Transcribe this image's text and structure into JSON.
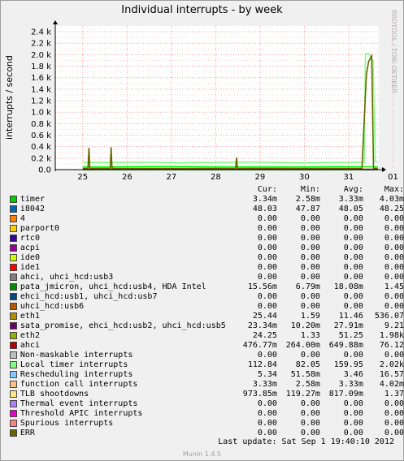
{
  "header": {
    "title": "Individual interrupts - by week",
    "watermark": "RRDTOOL / TOBI OETIKER"
  },
  "chart_data": {
    "type": "line",
    "title": "Individual interrupts - by week",
    "ylabel": "interrupts / second",
    "ylim": [
      0,
      2500
    ],
    "y_ticks": [
      "0.0",
      "0.2 k",
      "0.4 k",
      "0.6 k",
      "0.8 k",
      "1.0 k",
      "1.2 k",
      "1.4 k",
      "1.6 k",
      "1.8 k",
      "2.0 k",
      "2.2 k",
      "2.4 k"
    ],
    "x_ticks": [
      "25",
      "26",
      "27",
      "28",
      "29",
      "30",
      "31",
      "01"
    ],
    "grid": true,
    "series": [
      {
        "name": "Local timer interrupts",
        "color": "#80ff80",
        "x": [
          0,
          0.5,
          1.0,
          1.6,
          2.2,
          3.0,
          3.9,
          4.5,
          5.0,
          5.8,
          6.2,
          6.35,
          6.38,
          6.45,
          6.5,
          6.55,
          6.6,
          6.66
        ],
        "values": [
          130,
          125,
          130,
          128,
          122,
          128,
          132,
          124,
          122,
          126,
          128,
          128,
          2020,
          2020,
          1950,
          1900,
          140,
          130
        ]
      },
      {
        "name": "eth2",
        "color": "#00ff00",
        "x": [
          0,
          0.5,
          1.0,
          2.0,
          3.0,
          4.0,
          5.0,
          6.0,
          6.66
        ],
        "values": [
          50,
          48,
          52,
          55,
          50,
          48,
          50,
          52,
          50
        ]
      },
      {
        "name": "sata_promise, ehci_hcd:usb2, uhci_hcd:usb5",
        "color": "#666600",
        "x": [
          0,
          0.12,
          0.14,
          0.16,
          0.5,
          0.62,
          0.64,
          0.66,
          1.0,
          2.0,
          3.45,
          3.47,
          3.49,
          4.0,
          6.3,
          6.4,
          6.45,
          6.52,
          6.56,
          6.6,
          6.66
        ],
        "values": [
          22,
          22,
          380,
          22,
          22,
          22,
          390,
          22,
          22,
          22,
          22,
          210,
          22,
          22,
          22,
          1650,
          1880,
          1980,
          22,
          22,
          22
        ]
      },
      {
        "name": "ahci",
        "color": "#cc0000",
        "x": [
          0,
          1.0,
          2.0,
          3.0,
          4.0,
          5.0,
          6.0,
          6.66
        ],
        "values": [
          5,
          4,
          5,
          4,
          5,
          4,
          5,
          5
        ]
      },
      {
        "name": "i8042",
        "color": "#0066b3",
        "x": [
          0,
          3.3,
          6.66
        ],
        "values": [
          0.05,
          0.05,
          0.05
        ]
      },
      {
        "name": "timer",
        "color": "#00cc00",
        "x": [
          0,
          3.3,
          6.66
        ],
        "values": [
          0.003,
          0.003,
          0.003
        ]
      }
    ]
  },
  "legend": {
    "headers": {
      "cur": "Cur:",
      "min": "Min:",
      "avg": "Avg:",
      "max": "Max:"
    },
    "rows": [
      {
        "name": "timer",
        "color": "#00cc00",
        "cur": "3.34m",
        "min": "2.58m",
        "avg": "3.33m",
        "max": "4.03m"
      },
      {
        "name": "i8042",
        "color": "#0066b3",
        "cur": "48.03",
        "min": "47.87",
        "avg": "48.05",
        "max": "48.25"
      },
      {
        "name": "4",
        "color": "#ff8000",
        "cur": "0.00",
        "min": "0.00",
        "avg": "0.00",
        "max": "0.00"
      },
      {
        "name": "parport0",
        "color": "#ffcc00",
        "cur": "0.00",
        "min": "0.00",
        "avg": "0.00",
        "max": "0.00"
      },
      {
        "name": "rtc0",
        "color": "#330099",
        "cur": "0.00",
        "min": "0.00",
        "avg": "0.00",
        "max": "0.00"
      },
      {
        "name": "acpi",
        "color": "#990099",
        "cur": "0.00",
        "min": "0.00",
        "avg": "0.00",
        "max": "0.00"
      },
      {
        "name": "ide0",
        "color": "#ccff00",
        "cur": "0.00",
        "min": "0.00",
        "avg": "0.00",
        "max": "0.00"
      },
      {
        "name": "ide1",
        "color": "#ff0000",
        "cur": "0.00",
        "min": "0.00",
        "avg": "0.00",
        "max": "0.00"
      },
      {
        "name": "ahci, uhci_hcd:usb3",
        "color": "#808080",
        "cur": "0.00",
        "min": "0.00",
        "avg": "0.00",
        "max": "0.00"
      },
      {
        "name": "pata_jmicron, uhci_hcd:usb4, HDA Intel",
        "color": "#008f00",
        "cur": "15.56m",
        "min": "6.79m",
        "avg": "18.08m",
        "max": "1.45"
      },
      {
        "name": "ehci_hcd:usb1, uhci_hcd:usb7",
        "color": "#00487d",
        "cur": "0.00",
        "min": "0.00",
        "avg": "0.00",
        "max": "0.00"
      },
      {
        "name": "uhci_hcd:usb6",
        "color": "#b35a00",
        "cur": "0.00",
        "min": "0.00",
        "avg": "0.00",
        "max": "0.00"
      },
      {
        "name": "eth1",
        "color": "#b38f00",
        "cur": "25.44",
        "min": "1.59",
        "avg": "11.46",
        "max": "536.07"
      },
      {
        "name": "sata_promise, ehci_hcd:usb2, uhci_hcd:usb5",
        "color": "#6b006b",
        "cur": "23.34m",
        "min": "10.20m",
        "avg": "27.91m",
        "max": "9.21"
      },
      {
        "name": "eth2",
        "color": "#8fb300",
        "cur": "24.25",
        "min": "1.33",
        "avg": "51.25",
        "max": "1.98k"
      },
      {
        "name": "ahci",
        "color": "#b30000",
        "cur": "476.77m",
        "min": "264.00m",
        "avg": "649.88m",
        "max": "76.12"
      },
      {
        "name": "Non-maskable interrupts",
        "color": "#bebebe",
        "cur": "0.00",
        "min": "0.00",
        "avg": "0.00",
        "max": "0.00"
      },
      {
        "name": "Local timer interrupts",
        "color": "#80ff80",
        "cur": "112.84",
        "min": "82.05",
        "avg": "159.95",
        "max": "2.02k"
      },
      {
        "name": "Rescheduling interrupts",
        "color": "#80c9ff",
        "cur": "5.34",
        "min": "51.58m",
        "avg": "3.46",
        "max": "16.57"
      },
      {
        "name": "function call interrupts",
        "color": "#ffc080",
        "cur": "3.33m",
        "min": "2.58m",
        "avg": "3.33m",
        "max": "4.02m"
      },
      {
        "name": "TLB shootdowns",
        "color": "#ffe680",
        "cur": "973.85m",
        "min": "119.27m",
        "avg": "817.09m",
        "max": "1.37"
      },
      {
        "name": "Thermal event interrupts",
        "color": "#aa80ff",
        "cur": "0.00",
        "min": "0.00",
        "avg": "0.00",
        "max": "0.00"
      },
      {
        "name": "Threshold APIC interrupts",
        "color": "#ee00cc",
        "cur": "0.00",
        "min": "0.00",
        "avg": "0.00",
        "max": "0.00"
      },
      {
        "name": "Spurious interrupts",
        "color": "#ff8080",
        "cur": "0.00",
        "min": "0.00",
        "avg": "0.00",
        "max": "0.00"
      },
      {
        "name": "ERR",
        "color": "#666600",
        "cur": "0.00",
        "min": "0.00",
        "avg": "0.00",
        "max": "0.00"
      }
    ]
  },
  "footer": {
    "last_update": "Last update:  Sat Sep  1 19:40:10 2012",
    "version": "Munin 1.4.5"
  }
}
